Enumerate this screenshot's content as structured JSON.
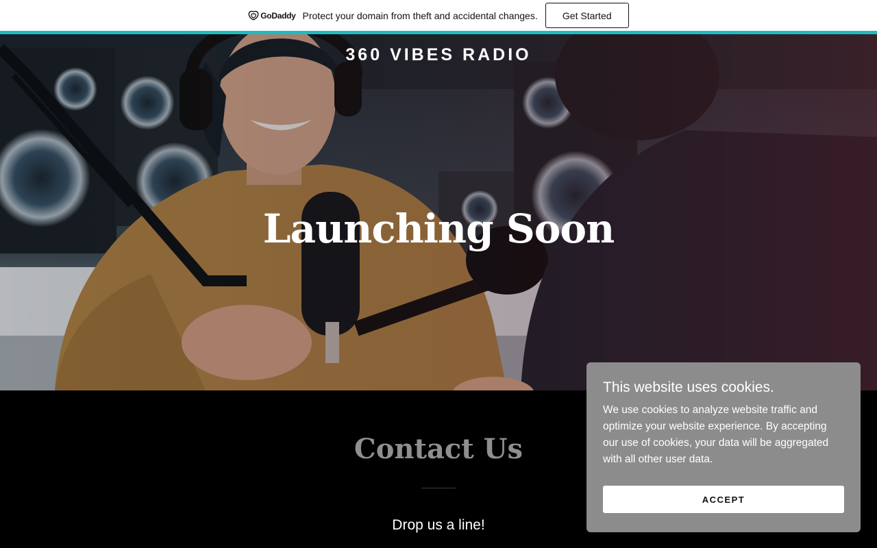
{
  "promo_banner": {
    "brand_name": "GoDaddy",
    "message": "Protect your domain from theft and accidental changes.",
    "cta_label": "Get Started",
    "accent_color": "#1bbdc1"
  },
  "hero": {
    "site_title": "360 VIBES RADIO",
    "heading": "Launching Soon"
  },
  "contact": {
    "title": "Contact Us",
    "subtitle": "Drop us a line!"
  },
  "cookie_dialog": {
    "title": "This website uses cookies.",
    "body": "We use cookies to analyze website traffic and optimize your website experience. By accepting our use of cookies, your data will be aggregated with all other user data.",
    "accept_label": "ACCEPT",
    "background_color": "#8c8c8c"
  }
}
